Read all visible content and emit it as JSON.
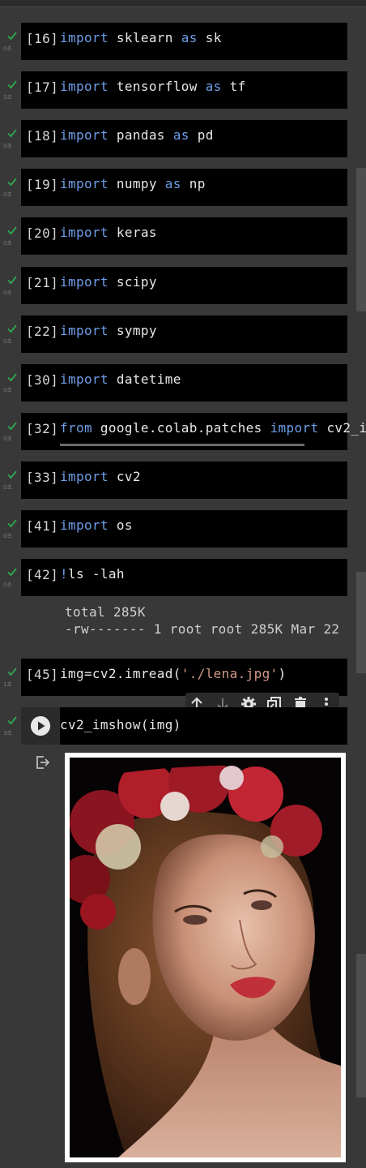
{
  "cells": [
    {
      "exec": "[16]",
      "time": "0초",
      "tokens": [
        [
          "kw",
          "import"
        ],
        [
          "t",
          " sklearn "
        ],
        [
          "kw",
          "as"
        ],
        [
          "t",
          " sk"
        ]
      ]
    },
    {
      "exec": "[17]",
      "time": "3초",
      "tokens": [
        [
          "kw",
          "import"
        ],
        [
          "t",
          " tensorflow "
        ],
        [
          "kw",
          "as"
        ],
        [
          "t",
          " tf"
        ]
      ]
    },
    {
      "exec": "[18]",
      "time": "0초",
      "tokens": [
        [
          "kw",
          "import"
        ],
        [
          "t",
          " pandas "
        ],
        [
          "kw",
          "as"
        ],
        [
          "t",
          " pd"
        ]
      ]
    },
    {
      "exec": "[19]",
      "time": "0초",
      "tokens": [
        [
          "kw",
          "import"
        ],
        [
          "t",
          " numpy "
        ],
        [
          "kw",
          "as"
        ],
        [
          "t",
          " np"
        ]
      ]
    },
    {
      "exec": "[20]",
      "time": "0초",
      "tokens": [
        [
          "kw",
          "import"
        ],
        [
          "t",
          " keras"
        ]
      ]
    },
    {
      "exec": "[21]",
      "time": "0초",
      "tokens": [
        [
          "kw",
          "import"
        ],
        [
          "t",
          " scipy"
        ]
      ]
    },
    {
      "exec": "[22]",
      "time": "0초",
      "tokens": [
        [
          "kw",
          "import"
        ],
        [
          "t",
          " sympy"
        ]
      ]
    },
    {
      "exec": "[30]",
      "time": "0초",
      "tokens": [
        [
          "kw",
          "import"
        ],
        [
          "t",
          " datetime"
        ]
      ]
    },
    {
      "exec": "[32]",
      "time": "0초",
      "tokens": [
        [
          "kw",
          "from"
        ],
        [
          "t",
          " google.colab.patches "
        ],
        [
          "kw",
          "import"
        ],
        [
          "t",
          " cv2_i"
        ]
      ]
    },
    {
      "exec": "[33]",
      "time": "0초",
      "tokens": [
        [
          "kw",
          "import"
        ],
        [
          "t",
          " cv2"
        ]
      ]
    },
    {
      "exec": "[41]",
      "time": "0초",
      "tokens": [
        [
          "kw",
          "import"
        ],
        [
          "t",
          " os"
        ]
      ]
    },
    {
      "exec": "[42]",
      "time": "0초",
      "tokens": [
        [
          "kw",
          "!"
        ],
        [
          "t",
          "ls -lah"
        ]
      ]
    }
  ],
  "ls_output": [
    "total 285K",
    "-rw------- 1 root root 285K Mar 22"
  ],
  "cell45": {
    "exec": "[45]",
    "time": "1초",
    "tokens": [
      [
        "t",
        "img=cv2.imread("
      ],
      [
        "str",
        "'./lena.jpg'"
      ],
      [
        "t",
        ")"
      ]
    ]
  },
  "cell_last": {
    "time": "3초",
    "code": "cv2_imshow(img)"
  },
  "toolbar": [
    "arrow-up-icon",
    "arrow-down-icon",
    "gear-icon",
    "mirror-cell-icon",
    "trash-icon",
    "more-vert-icon"
  ],
  "colors": {
    "keyword": "#6e9ee8",
    "string": "#d29a8a",
    "check": "#2fa84f",
    "cell_bg": "#000000",
    "page_bg": "#383838"
  }
}
